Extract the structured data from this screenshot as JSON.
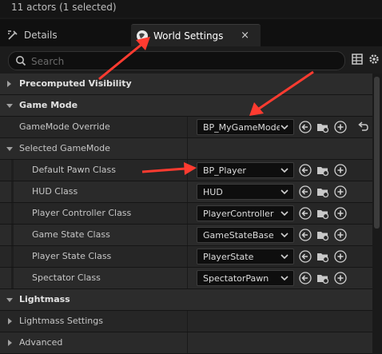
{
  "status": {
    "text": "11 actors (1 selected)"
  },
  "tabs": {
    "details": "Details",
    "world_settings": "World Settings",
    "close_glyph": "×"
  },
  "search": {
    "placeholder": "Search"
  },
  "categories": {
    "precomputed_visibility": "Precomputed Visibility",
    "game_mode": "Game Mode",
    "lightmass": "Lightmass",
    "lightmass_settings": "Lightmass Settings",
    "advanced": "Advanced"
  },
  "game_mode": {
    "override_label": "GameMode Override",
    "override_value": "BP_MyGameMode",
    "selected_label": "Selected GameMode",
    "rows": [
      {
        "label": "Default Pawn Class",
        "value": "BP_Player"
      },
      {
        "label": "HUD Class",
        "value": "HUD"
      },
      {
        "label": "Player Controller Class",
        "value": "PlayerController"
      },
      {
        "label": "Game State Class",
        "value": "GameStateBase"
      },
      {
        "label": "Player State Class",
        "value": "PlayerState"
      },
      {
        "label": "Spectator Class",
        "value": "SpectatorPawn"
      }
    ]
  },
  "colors": {
    "annotation_arrow": "#ff3b30",
    "panel_bg": "#242424",
    "accent_text": "#ffffff"
  }
}
